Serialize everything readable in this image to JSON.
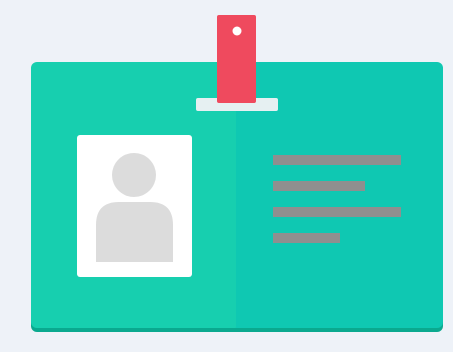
{
  "illustration": {
    "icon": "id-badge-icon",
    "colors": {
      "background": "#eef2f8",
      "card_left": "#17cfaf",
      "card_right": "#0fc8b2",
      "card_shadow": "#0aa98f",
      "clip_red": "#ef4a5e",
      "clip_hole": "#ffffff",
      "clip_bar": "#e6f0f2",
      "photo_frame": "#ffffff",
      "avatar": "#dcdcdc",
      "info_lines": "#8f8f8f"
    },
    "info_line_lengths": [
      1.0,
      0.72,
      1.0,
      0.52
    ]
  }
}
